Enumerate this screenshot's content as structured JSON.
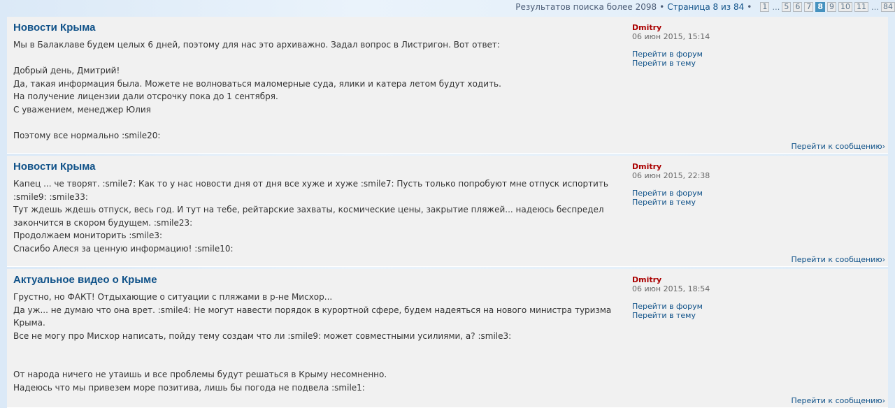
{
  "pagination": {
    "results_text": "Результатов поиска более 2098",
    "bullet": "•",
    "page_text": "Страница 8 из 84",
    "pages": [
      "1",
      "…",
      "5",
      "6",
      "7",
      "8",
      "9",
      "10",
      "11",
      "…",
      "84"
    ],
    "current_page": "8"
  },
  "posts": [
    {
      "title": "Новости Крыма",
      "author": "Dmitry",
      "date": "06 июн 2015, 15:14",
      "goto_forum": "Перейти в форум",
      "goto_topic": "Перейти в тему",
      "goto_post": "Перейти к сообщению›",
      "lines": [
        "Мы в Балаклаве будем целых 6 дней, поэтому для нас это архиважно. Задал вопрос в Листригон. Вот ответ:",
        "",
        "Добрый день, Дмитрий!",
        "Да, такая информация была. Можете не волноваться маломерные суда, ялики и катера летом будут ходить.",
        "На получение лицензии дали отсрочку пока до 1 сентября.",
        "С уважением, менеджер Юлия",
        "",
        "Поэтому все нормально :smile20:"
      ]
    },
    {
      "title": "Новости Крыма",
      "author": "Dmitry",
      "date": "06 июн 2015, 22:38",
      "goto_forum": "Перейти в форум",
      "goto_topic": "Перейти в тему",
      "goto_post": "Перейти к сообщению›",
      "lines": [
        "Капец ... че творят. :smile7: Как то у нас новости дня от дня все хуже и хуже :smile7: Пусть только попробуют мне отпуск испортить",
        ":smile9: :smile33:",
        "Тут ждешь ждешь отпуск, весь год. И тут на тебе, рейтарские захваты, космические цены, закрытие пляжей... надеюсь беспредел",
        "закончится в скором будущем. :smile23:",
        "Продолжаем мониторить :smile3:",
        "Спасибо Алеся за ценную информацию! :smile10:"
      ]
    },
    {
      "title": "Актуальное видео о Крыме",
      "author": "Dmitry",
      "date": "06 июн 2015, 18:54",
      "goto_forum": "Перейти в форум",
      "goto_topic": "Перейти в тему",
      "goto_post": "Перейти к сообщению›",
      "lines": [
        "Грустно, но ФАКТ! Отдыхающие о ситуации с пляжами в р-не Мисхор...",
        "Да уж... не думаю что она врет. :smile4: Не могут навести порядок в курортной сфере, будем надеяться на нового министра туризма",
        "Крыма.",
        "Все не могу про Мисхор написать, пойду тему создам что ли :smile9: может совместными усилиями, а? :smile3:",
        "",
        "",
        "От народа ничего не утаишь и все проблемы будут решаться в Крыму несомненно.",
        "Надеюсь что мы привезем море позитива, лишь бы погода не подвела :smile1:"
      ]
    }
  ]
}
